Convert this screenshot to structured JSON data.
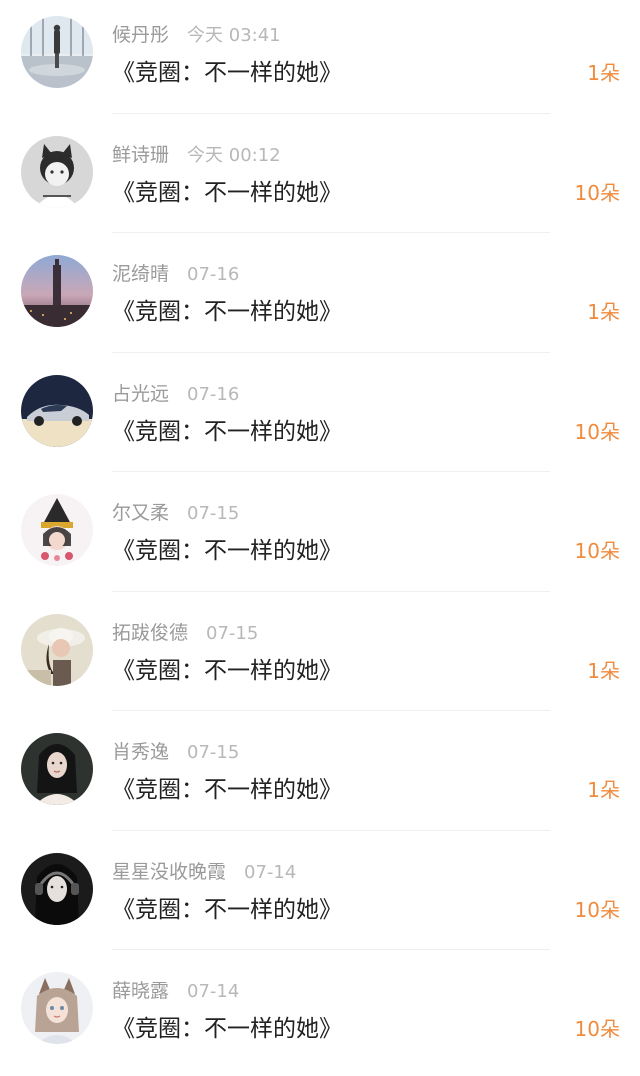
{
  "rewards": [
    {
      "name": "候丹彤",
      "time": "今天 03:41",
      "gift": "《竞圈：不一样的她》",
      "amount": "1朵",
      "avatar_icon": "avatar-city-window-icon"
    },
    {
      "name": "鲜诗珊",
      "time": "今天 00:12",
      "gift": "《竞圈：不一样的她》",
      "amount": "10朵",
      "avatar_icon": "avatar-cat-hat-girl-icon"
    },
    {
      "name": "泥绮晴",
      "time": "07-16",
      "gift": "《竞圈：不一样的她》",
      "amount": "1朵",
      "avatar_icon": "avatar-taipei-tower-icon"
    },
    {
      "name": "占光远",
      "time": "07-16",
      "gift": "《竞圈：不一样的她》",
      "amount": "10朵",
      "avatar_icon": "avatar-car-icon"
    },
    {
      "name": "尔又柔",
      "time": "07-15",
      "gift": "《竞圈：不一样的她》",
      "amount": "10朵",
      "avatar_icon": "avatar-anime-doll-icon"
    },
    {
      "name": "拓跋俊德",
      "time": "07-15",
      "gift": "《竞圈：不一样的她》",
      "amount": "1朵",
      "avatar_icon": "avatar-woman-hat-icon"
    },
    {
      "name": "肖秀逸",
      "time": "07-15",
      "gift": "《竞圈：不一样的她》",
      "amount": "1朵",
      "avatar_icon": "avatar-woman-portrait-icon"
    },
    {
      "name": "星星没收晚霞",
      "time": "07-14",
      "gift": "《竞圈：不一样的她》",
      "amount": "10朵",
      "avatar_icon": "avatar-headphones-girl-icon"
    },
    {
      "name": "薛晓露",
      "time": "07-14",
      "gift": "《竞圈：不一样的她》",
      "amount": "10朵",
      "avatar_icon": "avatar-anime-fox-girl-icon"
    }
  ],
  "colors": {
    "name": "#9a9a9a",
    "time": "#b8b8b8",
    "gift": "#222222",
    "amount": "#f08a3c",
    "divider": "#efefef"
  }
}
